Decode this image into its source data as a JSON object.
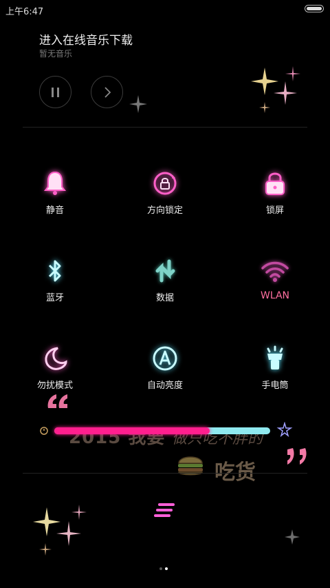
{
  "status_bar": {
    "time": "上午6:47"
  },
  "music": {
    "title": "进入在线音乐下载",
    "subtitle": "暂无音乐",
    "pause_icon": "pause-icon",
    "next_icon": "chevron-right-icon"
  },
  "toggles": [
    {
      "label": "静音",
      "icon": "bell-icon",
      "color": "#ff5fc8"
    },
    {
      "label": "方向锁定",
      "icon": "rotation-lock-icon",
      "color": "#ff5fc8"
    },
    {
      "label": "锁屏",
      "icon": "lock-icon",
      "color": "#ff5fc8"
    },
    {
      "label": "蓝牙",
      "icon": "bluetooth-icon",
      "color": "#9ff3ff"
    },
    {
      "label": "数据",
      "icon": "data-arrows-icon",
      "color": "#7fd3c8"
    },
    {
      "label": "WLAN",
      "icon": "wifi-icon",
      "color": "#c24aa0"
    },
    {
      "label": "勿扰模式",
      "icon": "moon-icon",
      "color": "#ff5fc8"
    },
    {
      "label": "自动亮度",
      "icon": "auto-brightness-icon",
      "color": "#9ff3ff"
    },
    {
      "label": "手电筒",
      "icon": "flashlight-icon",
      "color": "#9ff3ff"
    }
  ],
  "brightness": {
    "level": 0.72,
    "fill_color": "#ff1f8e",
    "track_color": "#8fe9ef"
  },
  "wallpaper": {
    "year_text": "2015 我要",
    "script_text": "做只吃不胖的",
    "foodie_text": "吃货"
  },
  "pager": {
    "pages": 2,
    "current": 1
  },
  "menu_icon": "menu-stripes-icon"
}
